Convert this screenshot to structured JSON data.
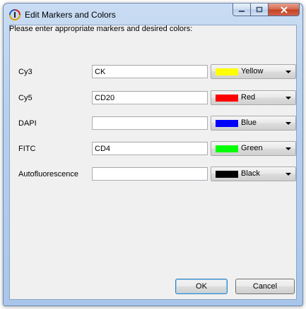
{
  "window": {
    "title": "Edit Markers and Colors"
  },
  "prompt": "Please enter appropriate markers and desired colors:",
  "rows": [
    {
      "label": "Cy3",
      "marker": "CK",
      "color_name": "Yellow",
      "color_hex": "#ffff00"
    },
    {
      "label": "Cy5",
      "marker": "CD20",
      "color_name": "Red",
      "color_hex": "#ff0000"
    },
    {
      "label": "DAPI",
      "marker": "",
      "color_name": "Blue",
      "color_hex": "#0000ff"
    },
    {
      "label": "FITC",
      "marker": "CD4",
      "color_name": "Green",
      "color_hex": "#00ff00"
    },
    {
      "label": "Autofluorescence",
      "marker": "",
      "color_name": "Black",
      "color_hex": "#000000"
    }
  ],
  "buttons": {
    "ok": "OK",
    "cancel": "Cancel"
  }
}
